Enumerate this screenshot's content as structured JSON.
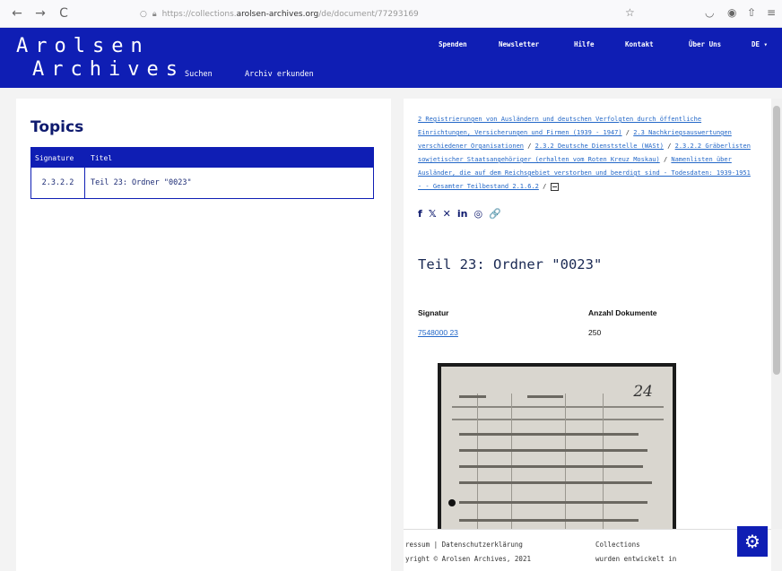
{
  "browser": {
    "back": "←",
    "forward": "→",
    "reload": "C",
    "url_prefix": "https://collections.",
    "url_host": "arolsen-archives.org",
    "url_path": "/de/document/77293169"
  },
  "header": {
    "logo_line1": "Arolsen",
    "logo_line2": "Archives",
    "subnav": [
      "Suchen",
      "Archiv erkunden"
    ],
    "topnav": [
      "Spenden",
      "Newsletter",
      "Hilfe",
      "Kontakt",
      "Über Uns"
    ],
    "language": "DE"
  },
  "topics": {
    "title": "Topics",
    "columns": [
      "Signature",
      "Titel"
    ],
    "rows": [
      {
        "signature": "2.3.2.2",
        "title": "Teil 23: Ordner \"0023\""
      }
    ]
  },
  "breadcrumb": {
    "items": [
      "2 Registrierungen von Ausländern und deutschen Verfolgten durch öffentliche Einrichtungen, Versicherungen und Firmen (1939 - 1947)",
      "2.3 Nachkriegsauswertungen verschiedener Organisationen",
      "2.3.2 Deutsche Dienststelle (WASt)",
      "2.3.2.2 Gräberlisten sowjetischer Staatsangehöriger (erhalten vom Roten Kreuz Moskau)",
      "Namenlisten über Ausländer, die auf dem Reichsgebiet verstorben und beerdigt sind - Todesdaten: 1939-1951 - - Gesamter Teilbestand 2.1.6.2"
    ],
    "separator": "/"
  },
  "share_icons": [
    "f",
    "𝕏",
    "✕",
    "in",
    "◎",
    "🔗"
  ],
  "document": {
    "title": "Teil 23: Ordner \"0023\"",
    "signatur_label": "Signatur",
    "signatur_value": "7548000 23",
    "count_label": "Anzahl Dokumente",
    "count_value": "250",
    "thumb_handwriting": "24"
  },
  "footer": {
    "left_line1": "ressum  |  Datenschutzerklärung",
    "left_line2": "yright © Arolsen Archives, 2021",
    "right_line1": "Collections",
    "right_line2": "wurden entwickelt in"
  },
  "colors": {
    "brand_blue": "#0f1eb4",
    "link_blue": "#2468c8"
  }
}
